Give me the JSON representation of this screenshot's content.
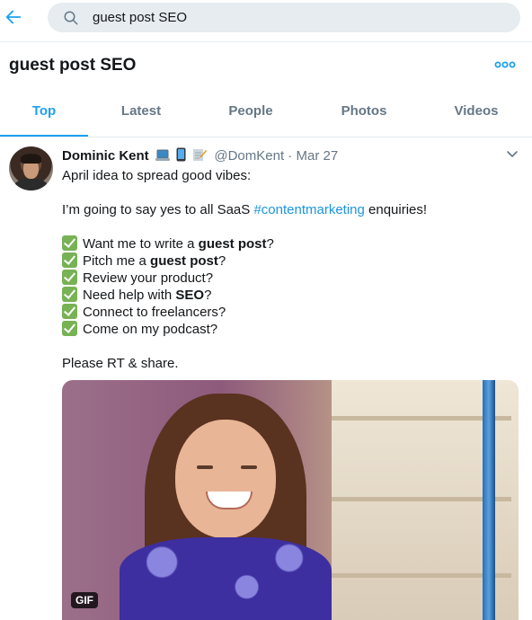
{
  "search": {
    "value": "guest post SEO"
  },
  "page_title": "guest post SEO",
  "tabs": [
    {
      "label": "Top",
      "active": true
    },
    {
      "label": "Latest",
      "active": false
    },
    {
      "label": "People",
      "active": false
    },
    {
      "label": "Photos",
      "active": false
    },
    {
      "label": "Videos",
      "active": false
    }
  ],
  "tweet": {
    "author_name": "Dominic Kent",
    "name_emojis": [
      "laptop-emoji",
      "mobile-phone-emoji",
      "memo-emoji"
    ],
    "handle": "@DomKent",
    "separator": " · ",
    "date": "Mar 27",
    "line1": "April idea to spread good vibes:",
    "line2_pre": "I’m going to say yes to all SaaS ",
    "hashtag": "#contentmarketing",
    "line2_post": " enquiries!",
    "items": [
      {
        "pre": "Want me to write a ",
        "bold": "guest post",
        "post": "?"
      },
      {
        "pre": "Pitch me a ",
        "bold": "guest post",
        "post": "?"
      },
      {
        "pre": "Review your product?",
        "bold": "",
        "post": ""
      },
      {
        "pre": "Need help with ",
        "bold": "SEO",
        "post": "?"
      },
      {
        "pre": "Connect to freelancers?",
        "bold": "",
        "post": ""
      },
      {
        "pre": "Come on my podcast?",
        "bold": "",
        "post": ""
      }
    ],
    "closing": "Please RT & share.",
    "media_badge": "GIF"
  },
  "colors": {
    "accent": "#1da1f2",
    "check": "#77b255",
    "muted": "#657786"
  }
}
